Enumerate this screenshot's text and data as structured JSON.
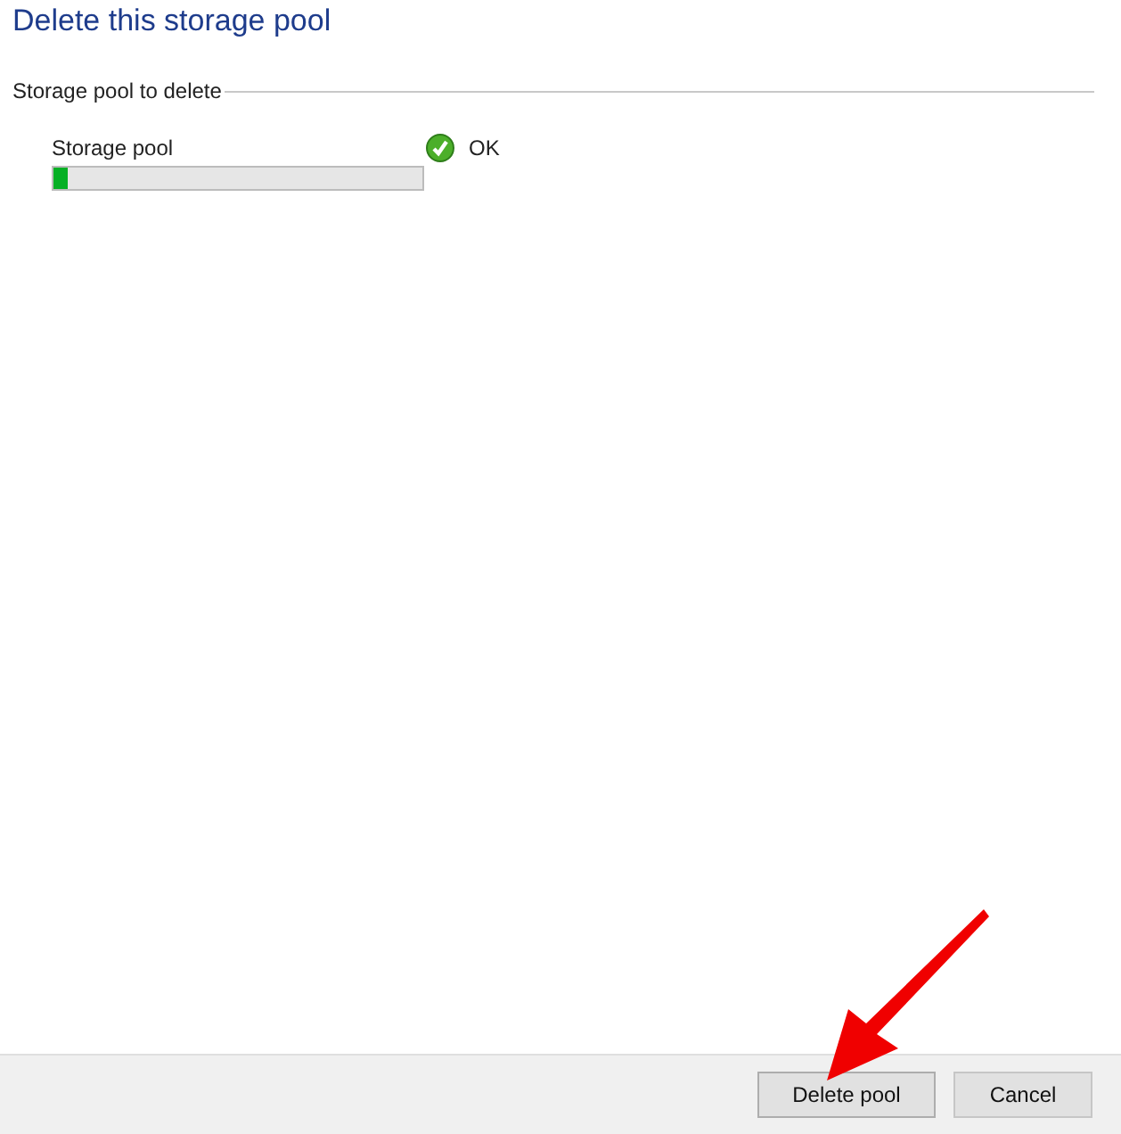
{
  "title": "Delete this storage pool",
  "group": {
    "label": "Storage pool to delete",
    "items": [
      {
        "name": "Storage pool",
        "status": "OK",
        "ok": true,
        "level": 0.04
      }
    ]
  },
  "buttons": [
    {
      "label": "Delete pool",
      "highlighted": true
    },
    {
      "label": "Cancel",
      "highlighted": false
    }
  ]
}
